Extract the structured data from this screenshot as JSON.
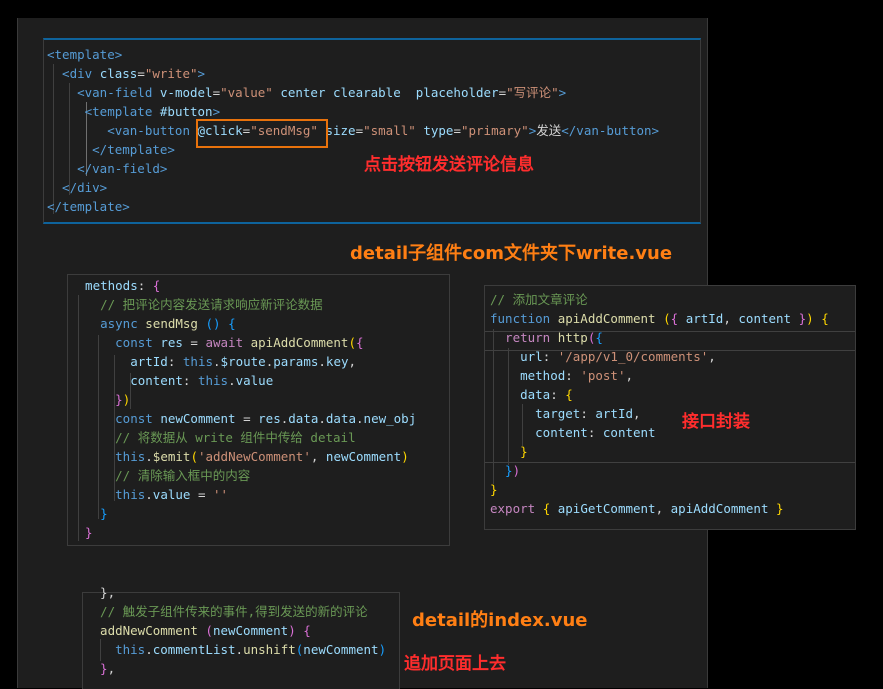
{
  "panels": {
    "write_template": {
      "lines": [
        [
          [
            "tag",
            "<template>"
          ]
        ],
        [
          [
            "tag",
            "  <div "
          ],
          [
            "attr",
            "class"
          ],
          [
            "pun",
            "="
          ],
          [
            "str",
            "\"write\""
          ],
          [
            "tag",
            ">"
          ]
        ],
        [
          [
            "tag",
            "    <van-field "
          ],
          [
            "attr",
            "v-model"
          ],
          [
            "pun",
            "="
          ],
          [
            "str",
            "\"value\""
          ],
          [
            "attr",
            " center clearable  placeholder"
          ],
          [
            "pun",
            "="
          ],
          [
            "str",
            "\"写评论\""
          ],
          [
            "tag",
            ">"
          ]
        ],
        [
          [
            "tag",
            "     <template "
          ],
          [
            "attr",
            "#button"
          ],
          [
            "tag",
            ">"
          ]
        ],
        [
          [
            "tag",
            "        <van-button "
          ],
          [
            "attr",
            "@click"
          ],
          [
            "pun",
            "="
          ],
          [
            "str",
            "\"sendMsg\""
          ],
          [
            "attr",
            " size"
          ],
          [
            "pun",
            "="
          ],
          [
            "str",
            "\"small\""
          ],
          [
            "attr",
            " type"
          ],
          [
            "pun",
            "="
          ],
          [
            "str",
            "\"primary\""
          ],
          [
            "tag",
            ">"
          ],
          [
            "txt",
            "发送"
          ],
          [
            "tag",
            "</van-button>"
          ]
        ],
        [
          [
            "tag",
            "      </template>"
          ]
        ],
        [
          [
            "tag",
            "    </van-field>"
          ]
        ],
        [
          [
            "tag",
            "  </div>"
          ]
        ],
        [
          [
            "tag",
            "</template>"
          ]
        ]
      ]
    },
    "write_methods": {
      "lines": [
        [
          [
            "prop",
            "  methods"
          ],
          [
            "pun",
            ": "
          ],
          [
            "br2",
            "{"
          ]
        ],
        [
          [
            "cmt",
            "    // 把评论内容发送请求响应新评论数据"
          ]
        ],
        [
          [
            "kw",
            "    async "
          ],
          [
            "fn",
            "sendMsg"
          ],
          [
            "pun",
            " "
          ],
          [
            "br3",
            "()"
          ],
          [
            "pun",
            " "
          ],
          [
            "br3",
            "{"
          ]
        ],
        [
          [
            "kw",
            "      const "
          ],
          [
            "prop",
            "res"
          ],
          [
            "pun",
            " = "
          ],
          [
            "ctl",
            "await "
          ],
          [
            "fn",
            "apiAddComment"
          ],
          [
            "br1",
            "("
          ],
          [
            "br2",
            "{"
          ]
        ],
        [
          [
            "prop",
            "        artId"
          ],
          [
            "pun",
            ": "
          ],
          [
            "kw",
            "this"
          ],
          [
            "pun",
            "."
          ],
          [
            "prop",
            "$route"
          ],
          [
            "pun",
            "."
          ],
          [
            "prop",
            "params"
          ],
          [
            "pun",
            "."
          ],
          [
            "prop",
            "key"
          ],
          [
            "pun",
            ","
          ]
        ],
        [
          [
            "prop",
            "        content"
          ],
          [
            "pun",
            ": "
          ],
          [
            "kw",
            "this"
          ],
          [
            "pun",
            "."
          ],
          [
            "prop",
            "value"
          ]
        ],
        [
          [
            "br2",
            "      }"
          ],
          [
            "br1",
            ")"
          ]
        ],
        [
          [
            "kw",
            "      const "
          ],
          [
            "prop",
            "newComment"
          ],
          [
            "pun",
            " = "
          ],
          [
            "prop",
            "res"
          ],
          [
            "pun",
            "."
          ],
          [
            "prop",
            "data"
          ],
          [
            "pun",
            "."
          ],
          [
            "prop",
            "data"
          ],
          [
            "pun",
            "."
          ],
          [
            "prop",
            "new_obj"
          ]
        ],
        [
          [
            "cmt",
            "      // 将数据从 write 组件中传给 detail"
          ]
        ],
        [
          [
            "kw",
            "      this"
          ],
          [
            "pun",
            "."
          ],
          [
            "fn",
            "$emit"
          ],
          [
            "br1",
            "("
          ],
          [
            "str",
            "'addNewComment'"
          ],
          [
            "pun",
            ", "
          ],
          [
            "prop",
            "newComment"
          ],
          [
            "br1",
            ")"
          ]
        ],
        [
          [
            "cmt",
            "      // 清除输入框中的内容"
          ]
        ],
        [
          [
            "kw",
            "      this"
          ],
          [
            "pun",
            "."
          ],
          [
            "prop",
            "value"
          ],
          [
            "pun",
            " = "
          ],
          [
            "str",
            "''"
          ]
        ],
        [
          [
            "br3",
            "    }"
          ]
        ],
        [
          [
            "br2",
            "  }"
          ]
        ]
      ]
    },
    "api": {
      "lines": [
        [
          [
            "cmt",
            "// 添加文章评论"
          ]
        ],
        [
          [
            "kw",
            "function "
          ],
          [
            "fn",
            "apiAddComment"
          ],
          [
            "pun",
            " "
          ],
          [
            "br1",
            "("
          ],
          [
            "br2",
            "{"
          ],
          [
            "prop",
            " artId"
          ],
          [
            "pun",
            ", "
          ],
          [
            "prop",
            "content"
          ],
          [
            "br2",
            " }"
          ],
          [
            "br1",
            ")"
          ],
          [
            "pun",
            " "
          ],
          [
            "br1",
            "{"
          ]
        ],
        [
          [
            "ctl",
            "  return "
          ],
          [
            "fn",
            "http"
          ],
          [
            "br2",
            "("
          ],
          [
            "br3",
            "{"
          ]
        ],
        [
          [
            "prop",
            "    url"
          ],
          [
            "pun",
            ": "
          ],
          [
            "str",
            "'/app/v1_0/comments'"
          ],
          [
            "pun",
            ","
          ]
        ],
        [
          [
            "prop",
            "    method"
          ],
          [
            "pun",
            ": "
          ],
          [
            "str",
            "'post'"
          ],
          [
            "pun",
            ","
          ]
        ],
        [
          [
            "prop",
            "    data"
          ],
          [
            "pun",
            ": "
          ],
          [
            "br1",
            "{"
          ]
        ],
        [
          [
            "prop",
            "      target"
          ],
          [
            "pun",
            ": "
          ],
          [
            "prop",
            "artId"
          ],
          [
            "pun",
            ","
          ]
        ],
        [
          [
            "prop",
            "      content"
          ],
          [
            "pun",
            ": "
          ],
          [
            "prop",
            "content"
          ]
        ],
        [
          [
            "br1",
            "    }"
          ]
        ],
        [
          [
            "br3",
            "  }"
          ],
          [
            "br2",
            ")"
          ]
        ],
        [
          [
            "br1",
            "}"
          ]
        ],
        [
          [
            "ctl",
            "export "
          ],
          [
            "br1",
            "{"
          ],
          [
            "prop",
            " apiGetComment"
          ],
          [
            "pun",
            ", "
          ],
          [
            "prop",
            "apiAddComment"
          ],
          [
            "br1",
            " }"
          ]
        ]
      ]
    },
    "index": {
      "lines": [
        [
          [
            "pun",
            "  },"
          ]
        ],
        [
          [
            "cmt",
            "  // 触发子组件传来的事件,得到发送的新的评论"
          ]
        ],
        [
          [
            "fn",
            "  addNewComment"
          ],
          [
            "pun",
            " "
          ],
          [
            "br2",
            "("
          ],
          [
            "prop",
            "newComment"
          ],
          [
            "br2",
            ")"
          ],
          [
            "pun",
            " "
          ],
          [
            "br2",
            "{"
          ]
        ],
        [
          [
            "kw",
            "    this"
          ],
          [
            "pun",
            "."
          ],
          [
            "prop",
            "commentList"
          ],
          [
            "pun",
            "."
          ],
          [
            "fn",
            "unshift"
          ],
          [
            "br3",
            "("
          ],
          [
            "prop",
            "newComment"
          ],
          [
            "br3",
            ")"
          ]
        ],
        [
          [
            "br2",
            "  }"
          ],
          [
            "pun",
            ","
          ]
        ]
      ]
    }
  },
  "annotations": {
    "click_note": "点击按钮发送评论信息",
    "write_file": "detail子组件com文件夹下write.vue",
    "api_note": "接口封装",
    "index_file": "detail的index.vue",
    "index_note": "追加页面上去"
  }
}
